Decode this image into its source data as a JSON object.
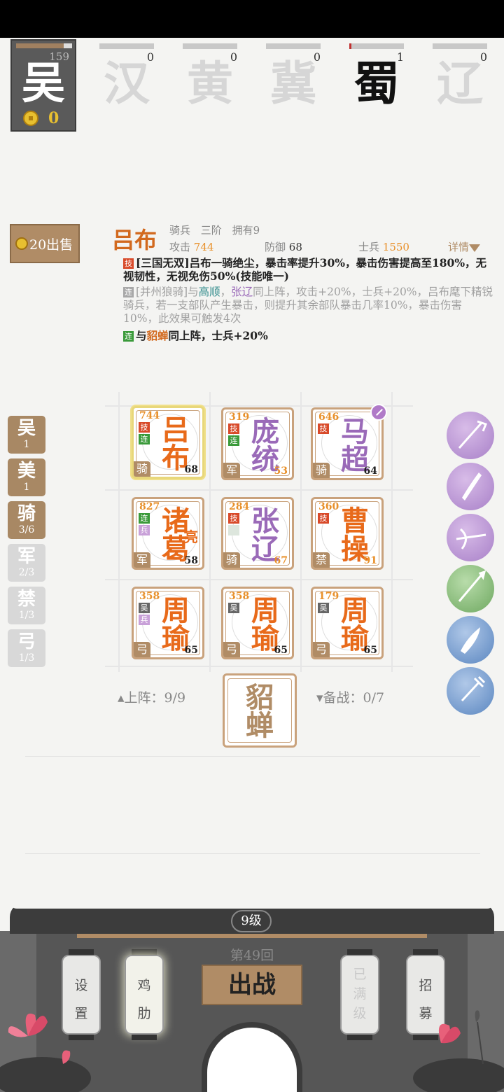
{
  "my_faction": {
    "name": "吴",
    "score": "159",
    "coins": "0",
    "hp_fraction": 0.85
  },
  "factions": [
    {
      "name": "汉",
      "value": "0",
      "active": false
    },
    {
      "name": "黄",
      "value": "0",
      "active": false
    },
    {
      "name": "冀",
      "value": "0",
      "active": false
    },
    {
      "name": "蜀",
      "value": "1",
      "active": true
    },
    {
      "name": "辽",
      "value": "0",
      "active": false
    }
  ],
  "sell_label": "20出售",
  "hero": {
    "name": "吕布",
    "type": "骑兵",
    "rank": "三阶",
    "owned": "拥有9",
    "attack_label": "攻击",
    "attack": "744",
    "defense_label": "防御",
    "defense": "68",
    "soldiers_label": "士兵",
    "soldiers": "1550",
    "detail_label": "详情"
  },
  "skills": {
    "skill_tag": "技",
    "link_tag": "连",
    "skill1": "[三国无双]吕布一骑绝尘，暴击率提升30%，暴击伤害提高至180%，无视韧性，无视免伤50%(技能唯一)",
    "skill2_a": "[并州狼骑]与",
    "skill2_hl1": "高顺",
    "skill2_sep": "，",
    "skill2_hl2": "张辽",
    "skill2_b": "同上阵，攻击+20%，士兵+20%，吕布麾下精锐骑兵，若一支部队产生暴击，则提升其余部队暴击几率10%，暴击伤害10%，此效果可触发4次",
    "skill3_a": "与",
    "skill3_hl": "貂蝉",
    "skill3_b": "同上阵，士兵+20%"
  },
  "cards": [
    {
      "power": "744",
      "n1": "吕",
      "n2": "布",
      "color": "orange",
      "tags": [
        {
          "t": "技",
          "c": "red"
        },
        {
          "t": "连",
          "c": "green"
        }
      ],
      "type": "骑",
      "level": "68",
      "level_color": "dark",
      "selected": true,
      "badge": false,
      "extra": ""
    },
    {
      "power": "319",
      "n1": "庞",
      "n2": "统",
      "color": "purple",
      "tags": [
        {
          "t": "技",
          "c": "red"
        },
        {
          "t": "连",
          "c": "green"
        }
      ],
      "type": "军",
      "level": "53",
      "level_color": "orange",
      "selected": false,
      "badge": false,
      "extra": ""
    },
    {
      "power": "646",
      "n1": "马",
      "n2": "超",
      "color": "purple",
      "tags": [
        {
          "t": "技",
          "c": "red"
        }
      ],
      "type": "骑",
      "level": "64",
      "level_color": "dark",
      "selected": false,
      "badge": true,
      "extra": ""
    },
    {
      "power": "827",
      "n1": "诸",
      "n2": "葛",
      "color": "orange",
      "tags": [
        {
          "t": "连",
          "c": "green"
        },
        {
          "t": "兵",
          "c": "lilac"
        }
      ],
      "type": "军",
      "level": "58",
      "level_color": "dark",
      "selected": false,
      "badge": false,
      "extra": "亮"
    },
    {
      "power": "284",
      "n1": "张",
      "n2": "辽",
      "color": "purple",
      "tags": [
        {
          "t": "技",
          "c": "red"
        },
        {
          "t": "",
          "c": "pale"
        }
      ],
      "type": "骑",
      "level": "67",
      "level_color": "orange",
      "selected": false,
      "badge": false,
      "extra": ""
    },
    {
      "power": "360",
      "n1": "曹",
      "n2": "操",
      "color": "orange",
      "tags": [
        {
          "t": "技",
          "c": "red"
        }
      ],
      "type": "禁",
      "level": "91",
      "level_color": "orange",
      "selected": false,
      "badge": false,
      "extra": ""
    },
    {
      "power": "358",
      "n1": "周",
      "n2": "瑜",
      "color": "orange",
      "tags": [
        {
          "t": "吴",
          "c": "gray"
        },
        {
          "t": "兵",
          "c": "lilac"
        }
      ],
      "type": "弓",
      "level": "65",
      "level_color": "dark",
      "selected": false,
      "badge": false,
      "extra": ""
    },
    {
      "power": "358",
      "n1": "周",
      "n2": "瑜",
      "color": "orange",
      "tags": [
        {
          "t": "吴",
          "c": "gray"
        }
      ],
      "type": "弓",
      "level": "65",
      "level_color": "dark",
      "selected": false,
      "badge": false,
      "extra": ""
    },
    {
      "power": "179",
      "n1": "周",
      "n2": "瑜",
      "color": "orange",
      "tags": [
        {
          "t": "吴",
          "c": "gray"
        }
      ],
      "type": "弓",
      "level": "65",
      "level_color": "dark",
      "selected": false,
      "badge": false,
      "extra": ""
    }
  ],
  "deploy_label": "▴上阵：9/9",
  "reserve_label": "▾备战：0/7",
  "bench": {
    "n1": "貂",
    "n2": "蝉"
  },
  "synergies": [
    {
      "t": "吴",
      "c": "1",
      "active": true
    },
    {
      "t": "美",
      "c": "1",
      "active": true
    },
    {
      "t": "骑",
      "c": "3/6",
      "active": true
    },
    {
      "t": "军",
      "c": "2/3",
      "active": false
    },
    {
      "t": "禁",
      "c": "1/3",
      "active": false
    },
    {
      "t": "弓",
      "c": "1/3",
      "active": false
    }
  ],
  "skill_icons": [
    {
      "icon": "halberd-icon",
      "color": "purple"
    },
    {
      "icon": "blade-icon",
      "color": "purple"
    },
    {
      "icon": "crossbow-icon",
      "color": "purple"
    },
    {
      "icon": "spear-icon",
      "color": "green"
    },
    {
      "icon": "saber-icon",
      "color": "blue"
    },
    {
      "icon": "mace-icon",
      "color": "blue"
    }
  ],
  "bottom": {
    "level": "9级",
    "round": "第49回",
    "fight": "出战",
    "settings_1": "设",
    "settings_2": "置",
    "boost_1": "鸡",
    "boost_2": "肋",
    "maxed_1": "已",
    "maxed_2": "满",
    "maxed_3": "级",
    "recruit_1": "招",
    "recruit_2": "募"
  }
}
